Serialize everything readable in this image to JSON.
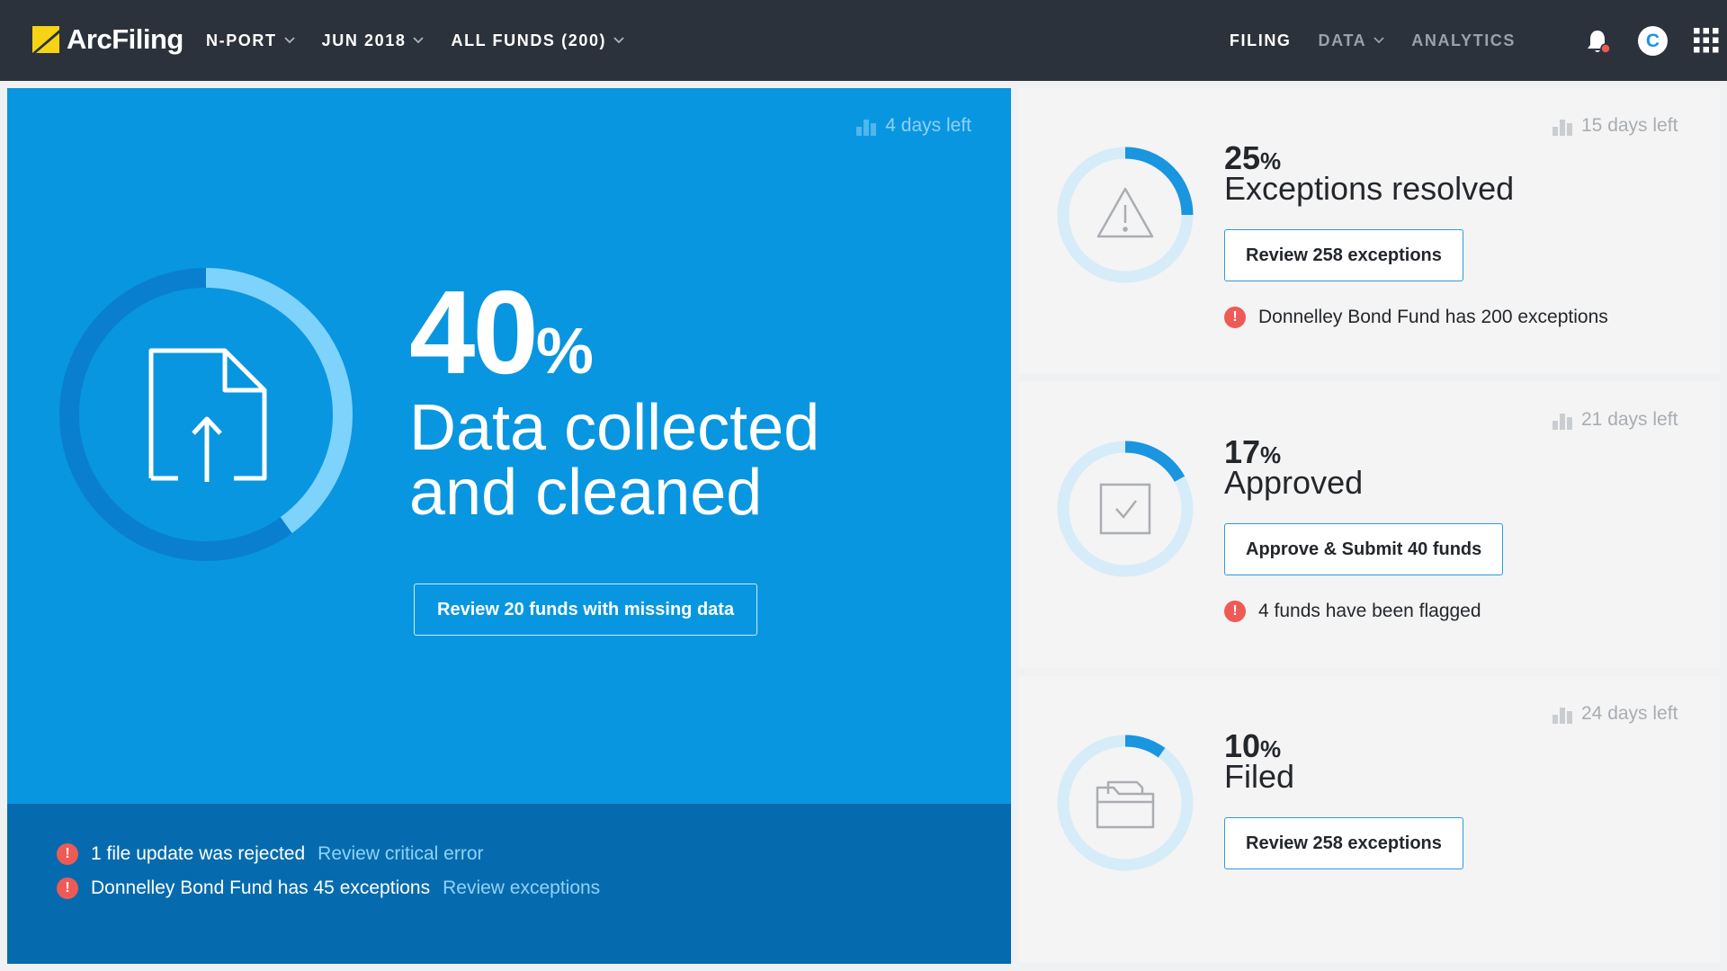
{
  "app": {
    "brand": "ArcFiling",
    "nav_left": [
      {
        "label": "N-PORT"
      },
      {
        "label": "JUN 2018"
      },
      {
        "label": "ALL FUNDS (200)"
      }
    ],
    "nav_right": [
      {
        "label": "FILING",
        "active": true
      },
      {
        "label": "DATA",
        "dropdown": true
      },
      {
        "label": "ANALYTICS"
      }
    ],
    "avatar_initial": "C",
    "icons": [
      "bell-icon",
      "apps-grid-icon",
      "chevron-down-icon"
    ],
    "colors": {
      "topbar": "#2c323b",
      "hero": "#0996e0",
      "hero_footer": "#066bae",
      "accent": "#2a9be0",
      "alert": "#ee5a56"
    }
  },
  "hero": {
    "days_left": "4 days left",
    "percent": "40",
    "percent_sign": "%",
    "progress": 0.4,
    "title_line1": "Data collected",
    "title_line2": "and cleaned",
    "button_label": "Review 20 funds with missing data",
    "alerts": [
      {
        "text": "1 file update was rejected",
        "link": "Review critical error"
      },
      {
        "text": "Donnelley Bond Fund has 45 exceptions",
        "link": "Review exceptions"
      }
    ]
  },
  "cards": [
    {
      "days_left": "15 days left",
      "percent": "25",
      "percent_sign": "%",
      "progress": 0.25,
      "title": "Exceptions resolved",
      "button_label": "Review 258 exceptions",
      "alert": "Donnelley Bond Fund has 200 exceptions",
      "icon": "warning-icon"
    },
    {
      "days_left": "21 days left",
      "percent": "17",
      "percent_sign": "%",
      "progress": 0.17,
      "title": "Approved",
      "button_label": "Approve & Submit 40 funds",
      "alert": "4 funds have been flagged",
      "icon": "checkbox-icon"
    },
    {
      "days_left": "24 days left",
      "percent": "10",
      "percent_sign": "%",
      "progress": 0.1,
      "title": "Filed",
      "button_label": "Review 258 exceptions",
      "alert": "",
      "icon": "folder-icon"
    }
  ]
}
